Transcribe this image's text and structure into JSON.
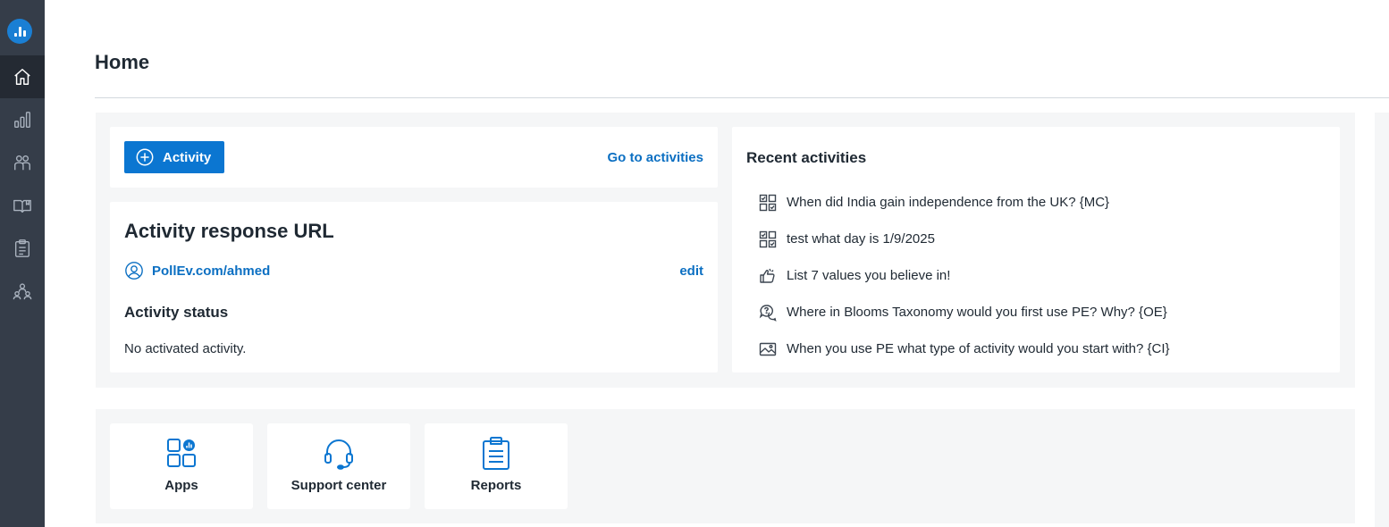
{
  "page": {
    "title": "Home"
  },
  "sidebar": {
    "items": [
      {
        "icon": "home-icon",
        "name": "Home"
      },
      {
        "icon": "bar-chart-icon",
        "name": "Activities"
      },
      {
        "icon": "participants-icon",
        "name": "Participants"
      },
      {
        "icon": "content-library-icon",
        "name": "Content"
      },
      {
        "icon": "clipboard-icon",
        "name": "Reports"
      },
      {
        "icon": "team-icon",
        "name": "Team"
      }
    ]
  },
  "activity_card": {
    "button_label": "Activity",
    "link_label": "Go to activities"
  },
  "response_url": {
    "heading": "Activity response URL",
    "url": "PollEv.com/ahmed",
    "edit_label": "edit",
    "status_heading": "Activity status",
    "status_text": "No activated activity."
  },
  "recent": {
    "heading": "Recent activities",
    "items": [
      {
        "icon": "multiple-choice-icon",
        "label": "When did India gain independence from the UK? {MC}"
      },
      {
        "icon": "multiple-choice-icon",
        "label": "test what day is 1/9/2025"
      },
      {
        "icon": "thumbs-icon",
        "label": "List 7 values you believe in!"
      },
      {
        "icon": "open-ended-icon",
        "label": "Where in Blooms Taxonomy would you first use PE? Why? {OE}"
      },
      {
        "icon": "image-icon",
        "label": "When you use PE what type of activity would you start with? {CI}"
      }
    ]
  },
  "tiles": [
    {
      "icon": "apps-icon",
      "label": "Apps"
    },
    {
      "icon": "headset-icon",
      "label": "Support center"
    },
    {
      "icon": "clipboard-icon",
      "label": "Reports"
    }
  ],
  "colors": {
    "sidebar": "#353d49",
    "sidebar_active": "#242a33",
    "accent": "#0b76d1",
    "link": "#0b6fc2",
    "panel": "#f5f6f7"
  }
}
